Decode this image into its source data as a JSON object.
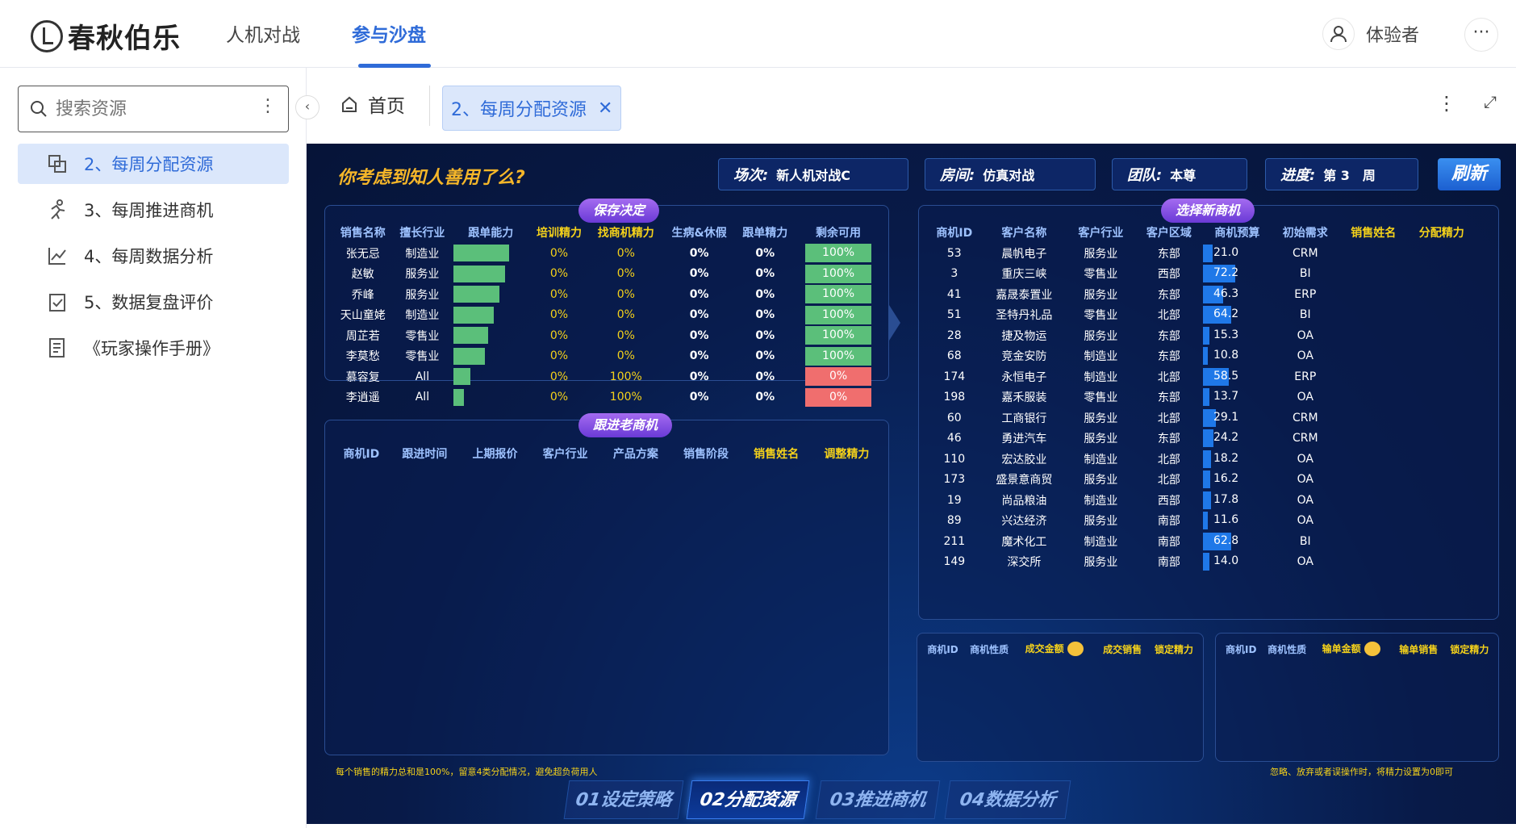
{
  "app": {
    "logo_text": "春秋伯乐"
  },
  "nav": {
    "items": [
      {
        "label": "人机对战"
      },
      {
        "label": "参与沙盘"
      }
    ]
  },
  "user": {
    "name": "体验者"
  },
  "sidebar": {
    "search_placeholder": "搜索资源",
    "items": [
      {
        "label": "2、每周分配资源",
        "icon": "allocate-icon"
      },
      {
        "label": "3、每周推进商机",
        "icon": "runner-icon"
      },
      {
        "label": "4、每周数据分析",
        "icon": "chart-icon"
      },
      {
        "label": "5、数据复盘评价",
        "icon": "clipboard-icon"
      },
      {
        "label": "《玩家操作手册》",
        "icon": "document-icon"
      }
    ]
  },
  "tabs": {
    "home": "首页",
    "active": "2、每周分配资源"
  },
  "dashboard": {
    "slogan": "你考虑到知人善用了么?",
    "session_label": "场次:",
    "session_value": "新人机对战C",
    "room_label": "房间:",
    "room_value": "仿真对战",
    "team_label": "团队:",
    "team_value": "本尊",
    "progress_label": "进度:",
    "progress_value": "第 3　周",
    "refresh": "刷新",
    "save_title": "保存决定",
    "sales_headers": [
      "销售名称",
      "擅长行业",
      "跟单能力",
      "培训精力",
      "找商机精力",
      "生病&休假",
      "跟单精力",
      "剩余可用"
    ],
    "sales": [
      {
        "name": "张无忌",
        "industry": "制造业",
        "ability": 0.98,
        "train": "0%",
        "find": "0%",
        "sick": "0%",
        "follow": "0%",
        "remain": "100%",
        "ok": true
      },
      {
        "name": "赵敏",
        "industry": "服务业",
        "ability": 0.92,
        "train": "0%",
        "find": "0%",
        "sick": "0%",
        "follow": "0%",
        "remain": "100%",
        "ok": true
      },
      {
        "name": "乔峰",
        "industry": "服务业",
        "ability": 0.82,
        "train": "0%",
        "find": "0%",
        "sick": "0%",
        "follow": "0%",
        "remain": "100%",
        "ok": true
      },
      {
        "name": "天山童姥",
        "industry": "制造业",
        "ability": 0.72,
        "train": "0%",
        "find": "0%",
        "sick": "0%",
        "follow": "0%",
        "remain": "100%",
        "ok": true
      },
      {
        "name": "周芷若",
        "industry": "零售业",
        "ability": 0.62,
        "train": "0%",
        "find": "0%",
        "sick": "0%",
        "follow": "0%",
        "remain": "100%",
        "ok": true
      },
      {
        "name": "李莫愁",
        "industry": "零售业",
        "ability": 0.55,
        "train": "0%",
        "find": "0%",
        "sick": "0%",
        "follow": "0%",
        "remain": "100%",
        "ok": true
      },
      {
        "name": "慕容复",
        "industry": "All",
        "ability": 0.3,
        "train": "0%",
        "find": "100%",
        "sick": "0%",
        "follow": "0%",
        "remain": "0%",
        "ok": false
      },
      {
        "name": "李逍遥",
        "industry": "All",
        "ability": 0.18,
        "train": "0%",
        "find": "100%",
        "sick": "0%",
        "follow": "0%",
        "remain": "0%",
        "ok": false
      }
    ],
    "old_title": "跟进老商机",
    "old_headers": [
      "商机ID",
      "跟进时间",
      "上期报价",
      "客户行业",
      "产品方案",
      "销售阶段",
      "销售姓名",
      "调整精力"
    ],
    "new_title": "选择新商机",
    "new_headers": [
      "商机ID",
      "客户名称",
      "客户行业",
      "客户区域",
      "商机预算",
      "初始需求",
      "销售姓名",
      "分配精力"
    ],
    "opps": [
      {
        "id": "53",
        "client": "晨帆电子",
        "industry": "服务业",
        "region": "东部",
        "budget": "21.0",
        "need": "CRM"
      },
      {
        "id": "3",
        "client": "重庆三峡",
        "industry": "零售业",
        "region": "西部",
        "budget": "72.2",
        "need": "BI"
      },
      {
        "id": "41",
        "client": "嘉晟泰置业",
        "industry": "服务业",
        "region": "东部",
        "budget": "46.3",
        "need": "ERP"
      },
      {
        "id": "51",
        "client": "圣特丹礼品",
        "industry": "零售业",
        "region": "北部",
        "budget": "64.2",
        "need": "BI"
      },
      {
        "id": "28",
        "client": "捷及物运",
        "industry": "服务业",
        "region": "东部",
        "budget": "15.3",
        "need": "OA"
      },
      {
        "id": "68",
        "client": "竞金安防",
        "industry": "制造业",
        "region": "东部",
        "budget": "10.8",
        "need": "OA"
      },
      {
        "id": "174",
        "client": "永恒电子",
        "industry": "制造业",
        "region": "北部",
        "budget": "58.5",
        "need": "ERP"
      },
      {
        "id": "198",
        "client": "嘉禾服装",
        "industry": "零售业",
        "region": "东部",
        "budget": "13.7",
        "need": "OA"
      },
      {
        "id": "60",
        "client": "工商银行",
        "industry": "服务业",
        "region": "北部",
        "budget": "29.1",
        "need": "CRM"
      },
      {
        "id": "46",
        "client": "勇进汽车",
        "industry": "服务业",
        "region": "东部",
        "budget": "24.2",
        "need": "CRM"
      },
      {
        "id": "110",
        "client": "宏达胶业",
        "industry": "制造业",
        "region": "北部",
        "budget": "18.2",
        "need": "OA"
      },
      {
        "id": "173",
        "client": "盛景意商贸",
        "industry": "服务业",
        "region": "北部",
        "budget": "16.2",
        "need": "OA"
      },
      {
        "id": "19",
        "client": "尚品粮油",
        "industry": "制造业",
        "region": "西部",
        "budget": "17.8",
        "need": "OA"
      },
      {
        "id": "89",
        "client": "兴达经济",
        "industry": "服务业",
        "region": "南部",
        "budget": "11.6",
        "need": "OA"
      },
      {
        "id": "211",
        "client": "魔术化工",
        "industry": "制造业",
        "region": "南部",
        "budget": "62.8",
        "need": "BI"
      },
      {
        "id": "149",
        "client": "深交所",
        "industry": "服务业",
        "region": "南部",
        "budget": "14.0",
        "need": "OA"
      }
    ],
    "won_headers": [
      "商机ID",
      "商机性质",
      "成交金额",
      "成交销售",
      "锁定精力"
    ],
    "lost_headers": [
      "商机ID",
      "商机性质",
      "输单金额",
      "输单销售",
      "锁定精力"
    ],
    "note_left": "每个销售的精力总和是100%，留意4类分配情况，避免超负荷用人",
    "note_right": "忽略、放弃或者误操作时，将精力设置为0即可",
    "steps": [
      "01设定策略",
      "02分配资源",
      "03推进商机",
      "04数据分析"
    ],
    "colors": {
      "green": "#5bbf7a",
      "red": "#f06e6e",
      "blue": "#1f78e8",
      "yellow": "#f5d21a",
      "accent": "#2f6bd8"
    }
  }
}
